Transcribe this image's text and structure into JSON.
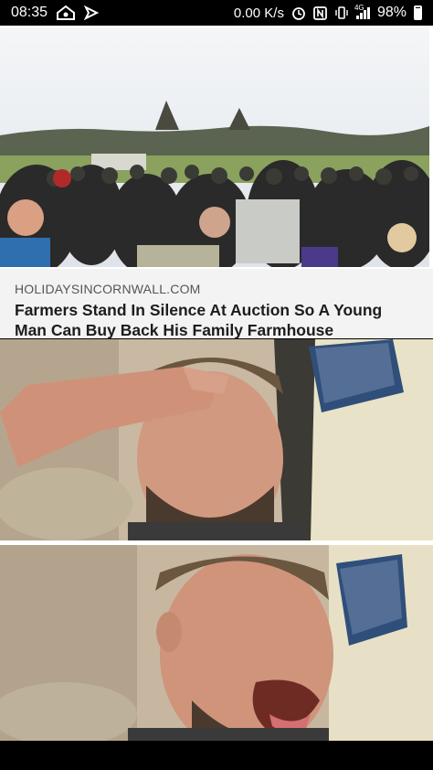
{
  "status_bar": {
    "time": "08:35",
    "net_speed": "0.00 K/s",
    "network_type": "4G",
    "battery": "98%",
    "icons": [
      "vpn-key-icon",
      "send-icon",
      "alarm-icon",
      "nfc-icon",
      "vibrate-icon",
      "signal-icon",
      "battery-icon"
    ]
  },
  "article": {
    "source": "HOLIDAYSINCORNWALL.COM",
    "headline_line1": "Farmers Stand In Silence At Auction So A Young",
    "headline_line2": "Man Can Buy Back His Family Farmhouse"
  },
  "colors": {
    "background": "#000000",
    "card_meta_bg": "#f3f3f3",
    "headline": "#1d1d1d",
    "source": "#555555"
  }
}
